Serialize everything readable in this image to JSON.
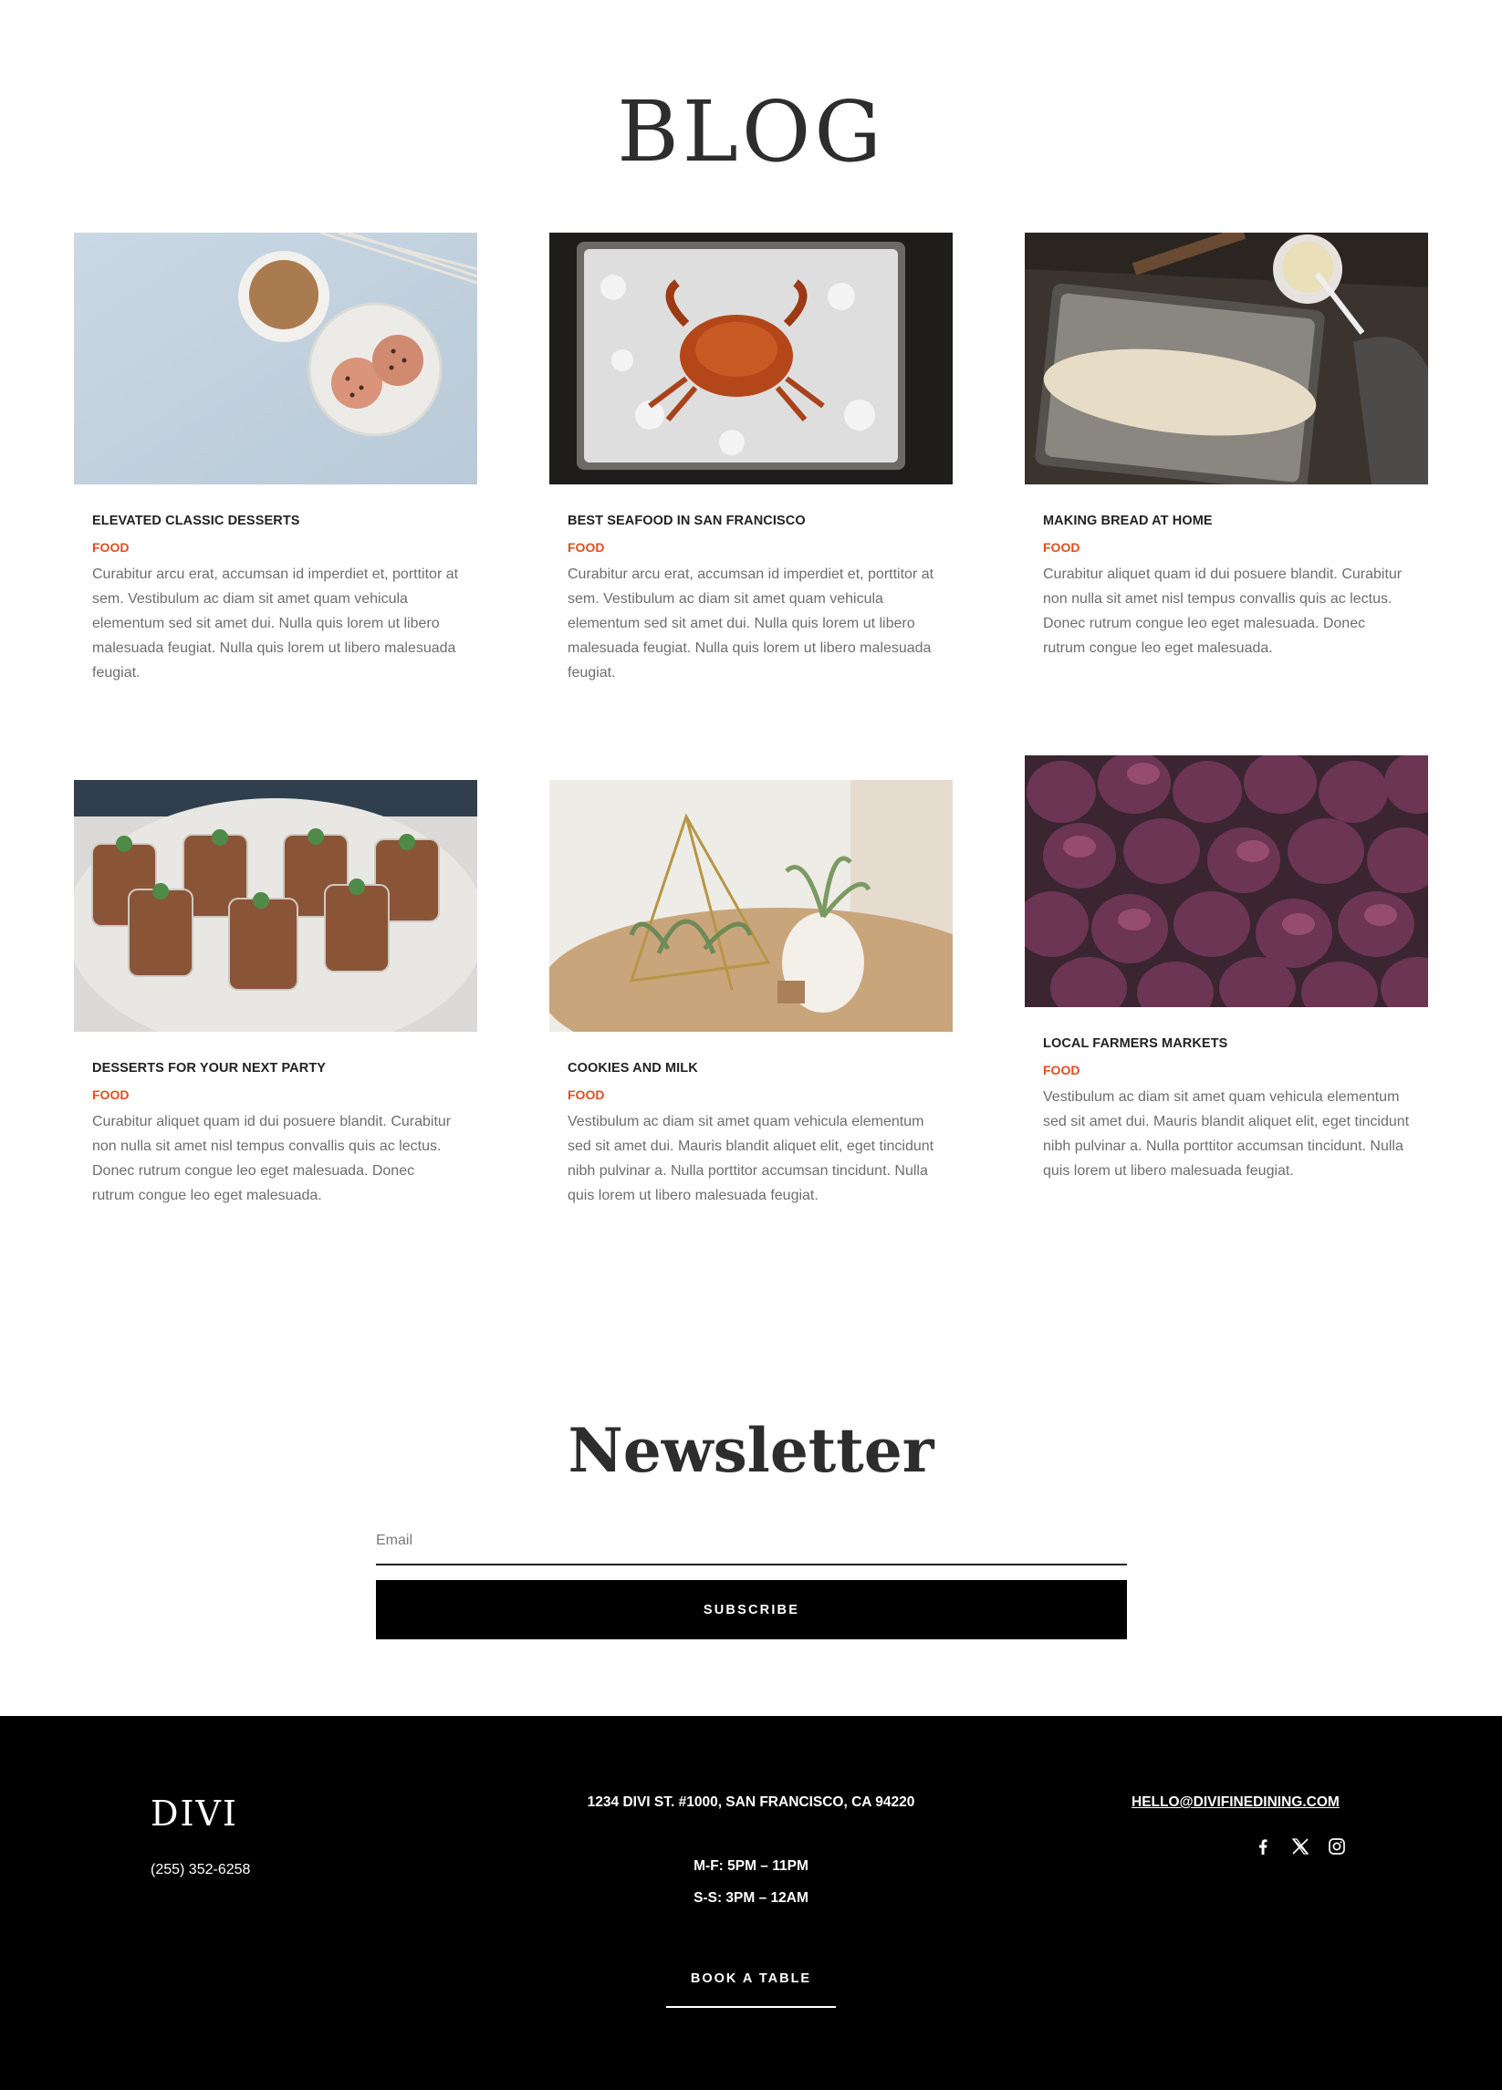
{
  "blog": {
    "title": "BLOG",
    "posts": [
      {
        "title": "ELEVATED CLASSIC DESSERTS",
        "category": "FOOD",
        "excerpt": "Curabitur arcu erat, accumsan id imperdiet et, porttitor at sem. Vestibulum ac diam sit amet quam vehicula elementum sed sit amet dui. Nulla quis lorem ut libero malesuada feugiat. Nulla quis lorem ut libero malesuada feugiat.",
        "image": "coffee-and-cookies-photo"
      },
      {
        "title": "BEST SEAFOOD IN SAN FRANCISCO",
        "category": "FOOD",
        "excerpt": "Curabitur arcu erat, accumsan id imperdiet et, porttitor at sem. Vestibulum ac diam sit amet quam vehicula elementum sed sit amet dui. Nulla quis lorem ut libero malesuada feugiat. Nulla quis lorem ut libero malesuada feugiat.",
        "image": "crab-on-ice-photo"
      },
      {
        "title": "MAKING BREAD AT HOME",
        "category": "FOOD",
        "excerpt": "Curabitur aliquet quam id dui posuere blandit. Curabitur non nulla sit amet nisl tempus convallis quis ac lectus. Donec rutrum congue leo eget malesuada. Donec rutrum congue leo eget malesuada.",
        "image": "bread-dough-photo"
      },
      {
        "title": "DESSERTS FOR YOUR NEXT PARTY",
        "category": "FOOD",
        "excerpt": "Curabitur aliquet quam id dui posuere blandit. Curabitur non nulla sit amet nisl tempus convallis quis ac lectus. Donec rutrum congue leo eget malesuada. Donec rutrum congue leo eget malesuada.",
        "image": "dessert-glasses-photo"
      },
      {
        "title": "COOKIES AND MILK",
        "category": "FOOD",
        "excerpt": "Vestibulum ac diam sit amet quam vehicula elementum sed sit amet dui. Mauris blandit aliquet elit, eget tincidunt nibh pulvinar a. Nulla porttitor accumsan tincidunt. Nulla quis lorem ut libero malesuada feugiat.",
        "image": "air-plants-photo"
      },
      {
        "title": "LOCAL FARMERS MARKETS",
        "category": "FOOD",
        "excerpt": "Vestibulum ac diam sit amet quam vehicula elementum sed sit amet dui. Mauris blandit aliquet elit, eget tincidunt nibh pulvinar a. Nulla porttitor accumsan tincidunt. Nulla quis lorem ut libero malesuada feugiat.",
        "image": "figs-photo"
      }
    ]
  },
  "newsletter": {
    "title": "Newsletter",
    "email_placeholder": "Email",
    "subscribe_label": "SUBSCRIBE"
  },
  "footer": {
    "brand": "DIVI",
    "phone": "(255) 352-6258",
    "address": "1234 DIVI ST. #1000, SAN FRANCISCO, CA 94220",
    "hours_weekday": "M-F: 5PM – 11PM",
    "hours_weekend": "S-S: 3PM – 12AM",
    "book_label": "BOOK A TABLE",
    "email": "HELLO@DIVIFINEDINING.COM",
    "social_icons": [
      "facebook-icon",
      "x-icon",
      "instagram-icon"
    ]
  },
  "colors": {
    "accent": "#e04e22",
    "text": "#222222",
    "muted": "#6e6e6e",
    "footer_bg": "#000000"
  }
}
